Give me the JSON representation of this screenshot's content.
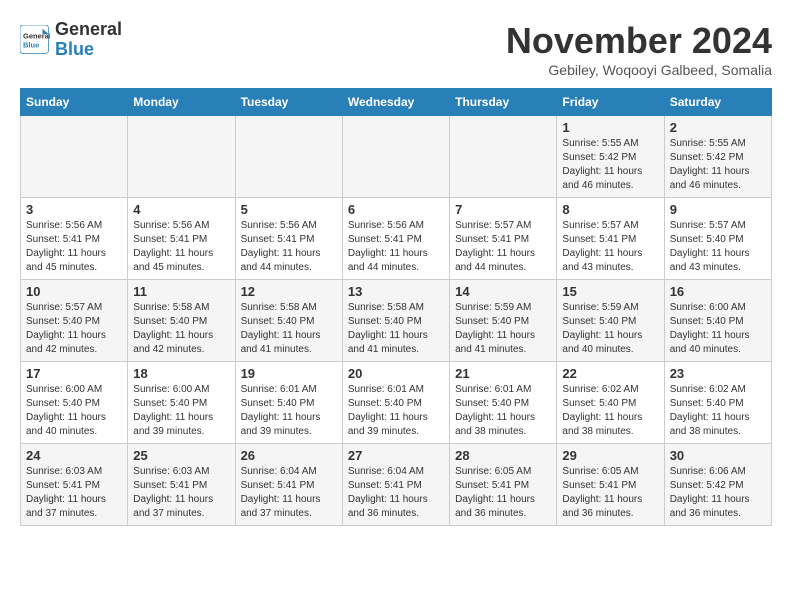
{
  "header": {
    "logo_general": "General",
    "logo_blue": "Blue",
    "month_title": "November 2024",
    "location": "Gebiley, Woqooyi Galbeed, Somalia"
  },
  "days_of_week": [
    "Sunday",
    "Monday",
    "Tuesday",
    "Wednesday",
    "Thursday",
    "Friday",
    "Saturday"
  ],
  "weeks": [
    [
      {
        "day": "",
        "info": ""
      },
      {
        "day": "",
        "info": ""
      },
      {
        "day": "",
        "info": ""
      },
      {
        "day": "",
        "info": ""
      },
      {
        "day": "",
        "info": ""
      },
      {
        "day": "1",
        "info": "Sunrise: 5:55 AM\nSunset: 5:42 PM\nDaylight: 11 hours and 46 minutes."
      },
      {
        "day": "2",
        "info": "Sunrise: 5:55 AM\nSunset: 5:42 PM\nDaylight: 11 hours and 46 minutes."
      }
    ],
    [
      {
        "day": "3",
        "info": "Sunrise: 5:56 AM\nSunset: 5:41 PM\nDaylight: 11 hours and 45 minutes."
      },
      {
        "day": "4",
        "info": "Sunrise: 5:56 AM\nSunset: 5:41 PM\nDaylight: 11 hours and 45 minutes."
      },
      {
        "day": "5",
        "info": "Sunrise: 5:56 AM\nSunset: 5:41 PM\nDaylight: 11 hours and 44 minutes."
      },
      {
        "day": "6",
        "info": "Sunrise: 5:56 AM\nSunset: 5:41 PM\nDaylight: 11 hours and 44 minutes."
      },
      {
        "day": "7",
        "info": "Sunrise: 5:57 AM\nSunset: 5:41 PM\nDaylight: 11 hours and 44 minutes."
      },
      {
        "day": "8",
        "info": "Sunrise: 5:57 AM\nSunset: 5:41 PM\nDaylight: 11 hours and 43 minutes."
      },
      {
        "day": "9",
        "info": "Sunrise: 5:57 AM\nSunset: 5:40 PM\nDaylight: 11 hours and 43 minutes."
      }
    ],
    [
      {
        "day": "10",
        "info": "Sunrise: 5:57 AM\nSunset: 5:40 PM\nDaylight: 11 hours and 42 minutes."
      },
      {
        "day": "11",
        "info": "Sunrise: 5:58 AM\nSunset: 5:40 PM\nDaylight: 11 hours and 42 minutes."
      },
      {
        "day": "12",
        "info": "Sunrise: 5:58 AM\nSunset: 5:40 PM\nDaylight: 11 hours and 41 minutes."
      },
      {
        "day": "13",
        "info": "Sunrise: 5:58 AM\nSunset: 5:40 PM\nDaylight: 11 hours and 41 minutes."
      },
      {
        "day": "14",
        "info": "Sunrise: 5:59 AM\nSunset: 5:40 PM\nDaylight: 11 hours and 41 minutes."
      },
      {
        "day": "15",
        "info": "Sunrise: 5:59 AM\nSunset: 5:40 PM\nDaylight: 11 hours and 40 minutes."
      },
      {
        "day": "16",
        "info": "Sunrise: 6:00 AM\nSunset: 5:40 PM\nDaylight: 11 hours and 40 minutes."
      }
    ],
    [
      {
        "day": "17",
        "info": "Sunrise: 6:00 AM\nSunset: 5:40 PM\nDaylight: 11 hours and 40 minutes."
      },
      {
        "day": "18",
        "info": "Sunrise: 6:00 AM\nSunset: 5:40 PM\nDaylight: 11 hours and 39 minutes."
      },
      {
        "day": "19",
        "info": "Sunrise: 6:01 AM\nSunset: 5:40 PM\nDaylight: 11 hours and 39 minutes."
      },
      {
        "day": "20",
        "info": "Sunrise: 6:01 AM\nSunset: 5:40 PM\nDaylight: 11 hours and 39 minutes."
      },
      {
        "day": "21",
        "info": "Sunrise: 6:01 AM\nSunset: 5:40 PM\nDaylight: 11 hours and 38 minutes."
      },
      {
        "day": "22",
        "info": "Sunrise: 6:02 AM\nSunset: 5:40 PM\nDaylight: 11 hours and 38 minutes."
      },
      {
        "day": "23",
        "info": "Sunrise: 6:02 AM\nSunset: 5:40 PM\nDaylight: 11 hours and 38 minutes."
      }
    ],
    [
      {
        "day": "24",
        "info": "Sunrise: 6:03 AM\nSunset: 5:41 PM\nDaylight: 11 hours and 37 minutes."
      },
      {
        "day": "25",
        "info": "Sunrise: 6:03 AM\nSunset: 5:41 PM\nDaylight: 11 hours and 37 minutes."
      },
      {
        "day": "26",
        "info": "Sunrise: 6:04 AM\nSunset: 5:41 PM\nDaylight: 11 hours and 37 minutes."
      },
      {
        "day": "27",
        "info": "Sunrise: 6:04 AM\nSunset: 5:41 PM\nDaylight: 11 hours and 36 minutes."
      },
      {
        "day": "28",
        "info": "Sunrise: 6:05 AM\nSunset: 5:41 PM\nDaylight: 11 hours and 36 minutes."
      },
      {
        "day": "29",
        "info": "Sunrise: 6:05 AM\nSunset: 5:41 PM\nDaylight: 11 hours and 36 minutes."
      },
      {
        "day": "30",
        "info": "Sunrise: 6:06 AM\nSunset: 5:42 PM\nDaylight: 11 hours and 36 minutes."
      }
    ]
  ]
}
